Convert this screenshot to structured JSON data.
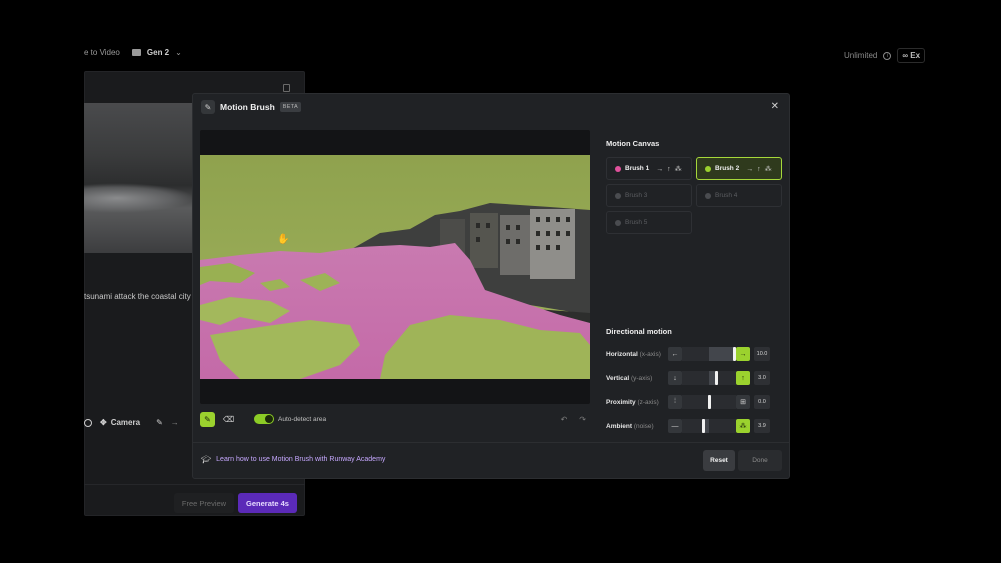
{
  "background": {
    "breadcrumb_prefix": "e to Video",
    "folder": "Gen 2",
    "plan": "Unlimited",
    "export_label": "Ex",
    "prompt": "tsunami attack the coastal city",
    "camera_label": "Camera",
    "free_preview_label": "Free Preview",
    "generate_label": "Generate 4s"
  },
  "modal": {
    "title": "Motion Brush",
    "badge": "BETA",
    "auto_detect_label": "Auto-detect area",
    "learn_link": "Learn how to use Motion Brush with Runway Academy",
    "reset_label": "Reset",
    "done_label": "Done",
    "motion_canvas_title": "Motion Canvas",
    "brushes": [
      {
        "label": "Brush 1",
        "color": "#e0519c",
        "arrows": "→ ↑ ⁂",
        "state": "active"
      },
      {
        "label": "Brush 2",
        "color": "#9bd22e",
        "arrows": "→ ↑ ⁂",
        "state": "selected"
      },
      {
        "label": "Brush 3",
        "state": "dim"
      },
      {
        "label": "Brush 4",
        "state": "dim"
      },
      {
        "label": "Brush 5",
        "state": "dim"
      }
    ],
    "directional_title": "Directional motion",
    "motions": [
      {
        "label": "Horizontal",
        "axis": "(x-axis)",
        "value": "10.0",
        "level": 1.0
      },
      {
        "label": "Vertical",
        "axis": "(y-axis)",
        "value": "3.0",
        "level": 0.65
      },
      {
        "label": "Proximity",
        "axis": "(z-axis)",
        "value": "0.0",
        "level": 0.5
      },
      {
        "label": "Ambient",
        "axis": "(noise)",
        "value": "3.9",
        "level": 0.4
      }
    ]
  }
}
